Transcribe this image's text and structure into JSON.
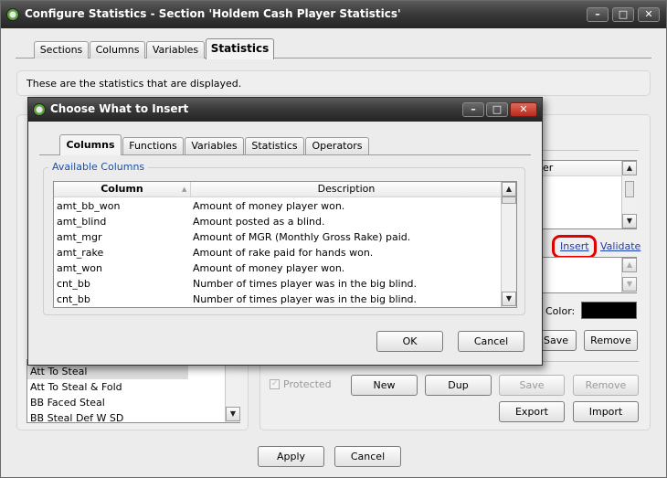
{
  "window": {
    "title": "Configure Statistics - Section 'Holdem Cash Player Statistics'",
    "controls": {
      "minimize": "–",
      "maximize": "□",
      "close": "✕"
    }
  },
  "tabs": [
    "Sections",
    "Columns",
    "Variables",
    "Statistics"
  ],
  "info_text": "These are the statistics that are displayed.",
  "background": {
    "col_header_partial": "er",
    "insert_link": "Insert",
    "validate_link": "Validate",
    "color_label": "Color:",
    "color_value": "#000000",
    "save_button": "Save",
    "remove_button": "Remove",
    "protected_label": "Protected",
    "new_button": "New",
    "dup_button": "Dup",
    "save2_button": "Save",
    "remove2_button": "Remove",
    "export_button": "Export",
    "import_button": "Import",
    "stat_list": [
      "Att To Steal",
      "Att To Steal & Fold",
      "BB Faced Steal",
      "BB Steal Def W SD"
    ],
    "apply_button": "Apply",
    "cancel_button": "Cancel",
    "highlight_color": "#e00000"
  },
  "dialog": {
    "title": "Choose What to Insert",
    "tabs": [
      "Columns",
      "Functions",
      "Variables",
      "Statistics",
      "Operators"
    ],
    "group_label": "Available Columns",
    "headers": {
      "column": "Column",
      "description": "Description"
    },
    "rows": [
      {
        "column": "amt_bb_won",
        "description": "Amount of money player won."
      },
      {
        "column": "amt_blind",
        "description": "Amount posted as a blind."
      },
      {
        "column": "amt_mgr",
        "description": "Amount of MGR (Monthly Gross Rake) paid."
      },
      {
        "column": "amt_rake",
        "description": "Amount of rake paid for hands won."
      },
      {
        "column": "amt_won",
        "description": "Amount of money player won."
      },
      {
        "column": "cnt_bb",
        "description": "Number of times player was in the big blind."
      },
      {
        "column": "cnt_bb",
        "description": "Number of times player was in the big blind."
      }
    ],
    "ok_button": "OK",
    "cancel_button": "Cancel"
  }
}
